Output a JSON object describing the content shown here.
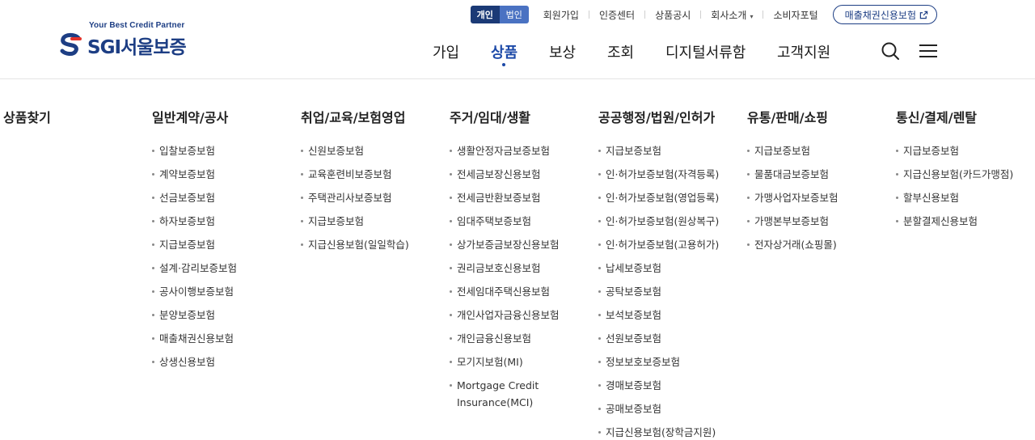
{
  "brand": {
    "tagline": "Your Best Credit Partner",
    "name": "SGI서울보증",
    "colors": {
      "navy": "#1d3e84",
      "red": "#e6332a",
      "accent": "#1d4aa8"
    }
  },
  "utility": {
    "toggle": {
      "personal": "개인",
      "corporate": "법인",
      "selected": "개인"
    },
    "links": [
      "회원가입",
      "인증센터",
      "상품공시",
      "회사소개",
      "소비자포털"
    ],
    "company_caret": "▾",
    "highlight_button": "매출채권신용보험",
    "highlight_icon": "external-link-icon"
  },
  "gnb": {
    "items": [
      "가입",
      "상품",
      "보상",
      "조회",
      "디지털서류함",
      "고객지원"
    ],
    "active": "상품",
    "tools": [
      "search-icon",
      "hamburger-menu-icon"
    ]
  },
  "menu": {
    "columns": [
      {
        "title": "상품찾기",
        "items": []
      },
      {
        "title": "일반계약/공사",
        "items": [
          "입찰보증보험",
          "계약보증보험",
          "선금보증보험",
          "하자보증보험",
          "지급보증보험",
          "설계·감리보증보험",
          "공사이행보증보험",
          "분양보증보험",
          "매출채권신용보험",
          "상생신용보험"
        ]
      },
      {
        "title": "취업/교육/보험영업",
        "items": [
          "신원보증보험",
          "교육훈련비보증보험",
          "주택관리사보증보험",
          "지급보증보험",
          "지급신용보험(일일학습)"
        ]
      },
      {
        "title": "주거/임대/생활",
        "items": [
          "생활안정자금보증보험",
          "전세금보장신용보험",
          "전세금반환보증보험",
          "임대주택보증보험",
          "상가보증금보장신용보험",
          "권리금보호신용보험",
          "전세임대주택신용보험",
          "개인사업자금융신용보험",
          "개인금융신용보험",
          "모기지보험(MI)",
          "Mortgage Credit Insurance(MCI)"
        ]
      },
      {
        "title": "공공행정/법원/인허가",
        "items": [
          "지급보증보험",
          "인·허가보증보험(자격등록)",
          "인·허가보증보험(영업등록)",
          "인·허가보증보험(원상복구)",
          "인·허가보증보험(고용허가)",
          "납세보증보험",
          "공탁보증보험",
          "보석보증보험",
          "선원보증보험",
          "정보보호보증보험",
          "경매보증보험",
          "공매보증보험",
          "지급신용보험(장학금지원)"
        ]
      },
      {
        "title": "유통/판매/쇼핑",
        "items": [
          "지급보증보험",
          "물품대금보증보험",
          "가맹사업자보증보험",
          "가맹본부보증보험",
          "전자상거래(쇼핑몰)"
        ]
      },
      {
        "title": "통신/결제/렌탈",
        "items": [
          "지급보증보험",
          "지급신용보험(카드가맹점)",
          "할부신용보험",
          "분할결제신용보험"
        ]
      }
    ]
  }
}
